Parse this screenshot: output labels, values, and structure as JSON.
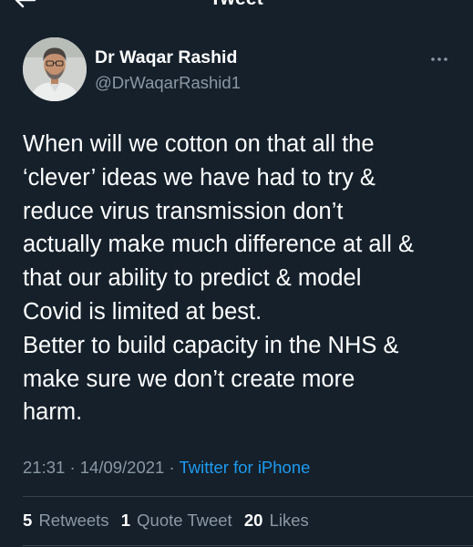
{
  "header": {
    "title": "Tweet",
    "back_icon": "arrow-left-icon"
  },
  "tweet": {
    "author": {
      "display_name": "Dr Waqar Rashid",
      "handle": "@DrWaqarRashid1",
      "avatar_icon": "avatar-photo"
    },
    "more_icon": "more-horizontal-icon",
    "text": "When will we cotton on that all the\n‘clever’ ideas we have had to try &\nreduce virus transmission don’t\nactually make much difference at all &\nthat our ability to predict & model\nCovid is limited at best.\nBetter to build capacity in the NHS &\nmake sure we don’t create more\nharm.",
    "time": "21:31",
    "date": "14/09/2021",
    "separator": "·",
    "source": "Twitter for iPhone"
  },
  "stats": {
    "retweets_count": "5",
    "retweets_label": "Retweets",
    "quotes_count": "1",
    "quotes_label": "Quote Tweet",
    "likes_count": "20",
    "likes_label": "Likes"
  },
  "colors": {
    "background": "#15202b",
    "text_primary": "#ffffff",
    "text_secondary": "#8b98a5",
    "link": "#1d9bf0",
    "divider": "#38444d"
  }
}
